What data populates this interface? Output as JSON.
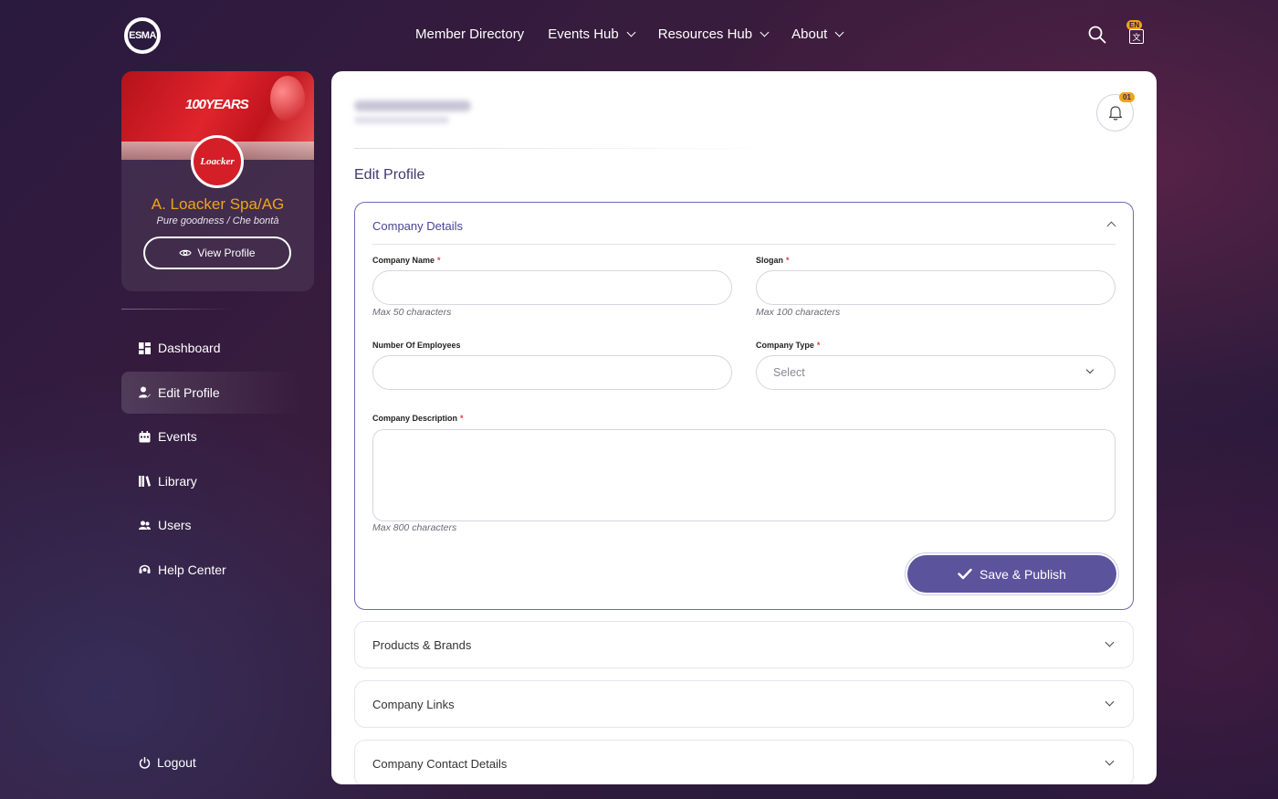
{
  "nav": {
    "logo_text": "ESMA",
    "items": [
      {
        "label": "Member Directory",
        "has_dropdown": false
      },
      {
        "label": "Events Hub",
        "has_dropdown": true
      },
      {
        "label": "Resources Hub",
        "has_dropdown": true
      },
      {
        "label": "About",
        "has_dropdown": true
      }
    ],
    "language_badge": "EN"
  },
  "profile": {
    "cover_text": "100YEARS",
    "brand_logo_text": "Loacker",
    "company_name": "A. Loacker Spa/AG",
    "slogan": "Pure goodness / Che bontà",
    "view_profile_label": "View Profile"
  },
  "sidebar": {
    "items": [
      {
        "label": "Dashboard",
        "icon": "dashboard-icon",
        "active": false
      },
      {
        "label": "Edit Profile",
        "icon": "user-edit-icon",
        "active": true
      },
      {
        "label": "Events",
        "icon": "calendar-icon",
        "active": false
      },
      {
        "label": "Library",
        "icon": "library-icon",
        "active": false
      },
      {
        "label": "Users",
        "icon": "users-icon",
        "active": false
      },
      {
        "label": "Help Center",
        "icon": "headset-icon",
        "active": false
      }
    ],
    "logout_label": "Logout"
  },
  "main": {
    "notification_count": "01",
    "page_title": "Edit Profile",
    "company_details": {
      "title": "Company Details",
      "company_name_label": "Company Name",
      "company_name_value": "",
      "company_name_hint": "Max 50 characters",
      "slogan_label": "Slogan",
      "slogan_value": "",
      "slogan_hint": "Max 100 characters",
      "employees_label": "Number Of Employees",
      "employees_value": "",
      "company_type_label": "Company Type",
      "company_type_placeholder": "Select",
      "description_label": "Company Description",
      "description_value": "",
      "description_hint": "Max 800 characters",
      "save_label": "Save & Publish"
    },
    "collapsed_sections": [
      {
        "title": "Products & Brands"
      },
      {
        "title": "Company Links"
      },
      {
        "title": "Company Contact Details"
      }
    ]
  },
  "colors": {
    "accent": "#5b549c",
    "brand_orange": "#f0a31b",
    "required": "#e03b3b"
  }
}
